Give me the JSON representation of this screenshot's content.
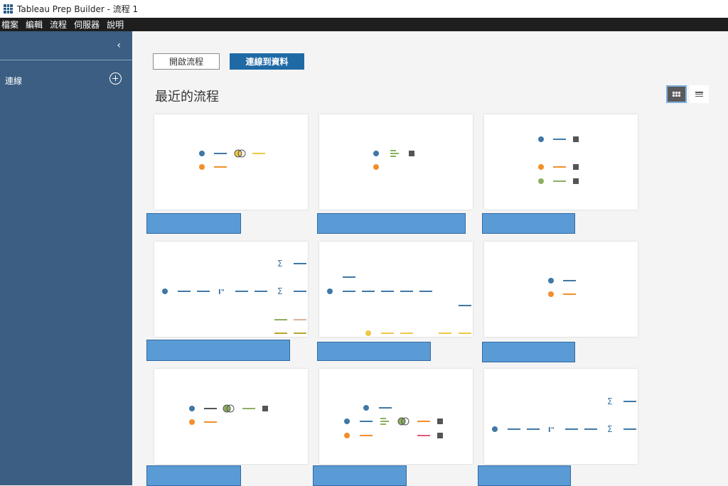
{
  "window": {
    "title": "Tableau Prep Builder - 流程 1"
  },
  "menu": [
    "檔案",
    "編輯",
    "流程",
    "伺服器",
    "說明"
  ],
  "sidebar": {
    "collapse_glyph": "‹",
    "connections_label": "連線"
  },
  "toolbar": {
    "open_flow_label": "開啟流程",
    "connect_label": "連線到資料"
  },
  "section": {
    "title": "最近的流程"
  },
  "icons": {
    "sum_glyph": "Σ",
    "pivot_glyph": "I\""
  },
  "colors": {
    "blue": "#3f77a6",
    "orange": "#f28e2b",
    "yellow": "#edc948",
    "green": "#8cb060",
    "gray": "#555555",
    "pink": "#e15777",
    "tan": "#d9b49a",
    "olive": "#b8a62e",
    "bar": "#5b9bd5",
    "sidebar": "#3b5e82",
    "primary_button": "#1f6aa5"
  }
}
